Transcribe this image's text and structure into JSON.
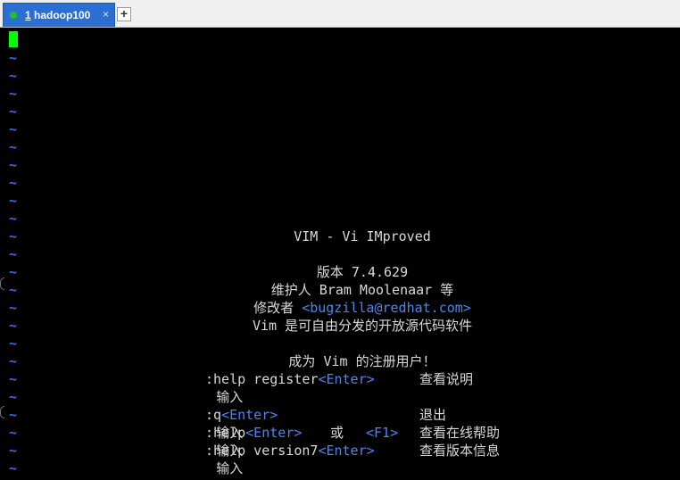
{
  "tab": {
    "number": "1",
    "title": "hadoop100",
    "close_glyph": "×",
    "status_color": "#23c123"
  },
  "new_tab_glyph": "+",
  "vim": {
    "tilde": "~",
    "title": "VIM - Vi IMproved",
    "version": "版本 7.4.629",
    "maintainer": "维护人 Bram Moolenaar 等",
    "modified_by_label": "修改者 ",
    "modified_by_email": "<bugzilla@redhat.com>",
    "license": "Vim 是可自由分发的开放源代码软件",
    "register_heading": "成为 Vim 的注册用户！",
    "commands": {
      "register": {
        "input_label": "输入",
        "command": ":help register",
        "key": "<Enter>",
        "description": "查看说明"
      },
      "quit": {
        "input_label": "输入",
        "command": ":q",
        "key": "<Enter>",
        "description": "退出"
      },
      "help": {
        "input_label": "输入",
        "command": ":help",
        "key": "<Enter>",
        "or_text": "或",
        "alt_key": "<F1>",
        "description": "查看在线帮助"
      },
      "version": {
        "input_label": "输入",
        "command": ":help version7",
        "key": "<Enter>",
        "description": "查看版本信息"
      }
    }
  },
  "colors": {
    "tilde": "#2f6ff2",
    "key_highlight": "#4a87f0",
    "cursor": "#00ff00",
    "tab_active": "#2b6fd3"
  }
}
